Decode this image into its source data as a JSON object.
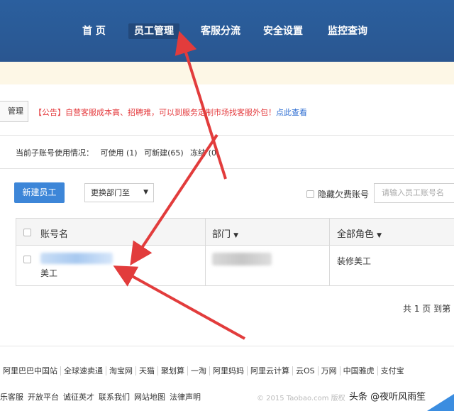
{
  "nav": {
    "items": [
      "首 页",
      "员工管理",
      "客服分流",
      "安全设置",
      "监控查询"
    ],
    "active_index": 1
  },
  "notice": {
    "tab_label": "管理",
    "announce_text": "【公告】自营客服成本高、招聘难，可以到服务定制市场找客服外包！",
    "announce_link": "点此查看"
  },
  "usage": {
    "label": "当前子账号使用情况：",
    "usable": "可使用 (1)",
    "creatable": "可新建(65)",
    "frozen": "冻结 (0)"
  },
  "toolbar": {
    "new_employee": "新建员工",
    "change_dept": "更换部门至",
    "hide_owe": "隐藏欠费账号",
    "search_placeholder": "请输入员工账号名"
  },
  "table": {
    "headers": [
      "账号名",
      "部门",
      "全部角色"
    ],
    "rows": [
      {
        "account_suffix": "美工",
        "role": "装修美工"
      }
    ]
  },
  "pagination": "共 1 页 到第",
  "footer": {
    "links": [
      "阿里巴巴中国站",
      "全球速卖通",
      "淘宝网",
      "天猫",
      "聚划算",
      "一淘",
      "阿里妈妈",
      "阿里云计算",
      "云OS",
      "万网",
      "中国雅虎",
      "支付宝"
    ],
    "links2": [
      "乐客服",
      "开放平台",
      "诚征英才",
      "联系我们",
      "网站地图",
      "法律声明"
    ],
    "copyright": "© 2015 Taobao.com 版权"
  },
  "watermark": "头条 @夜听风雨笙",
  "colors": {
    "nav_bg": "#2b5f9e",
    "primary": "#3d86d8",
    "notice_red": "#e4393c",
    "arrow": "#e23c3c"
  }
}
